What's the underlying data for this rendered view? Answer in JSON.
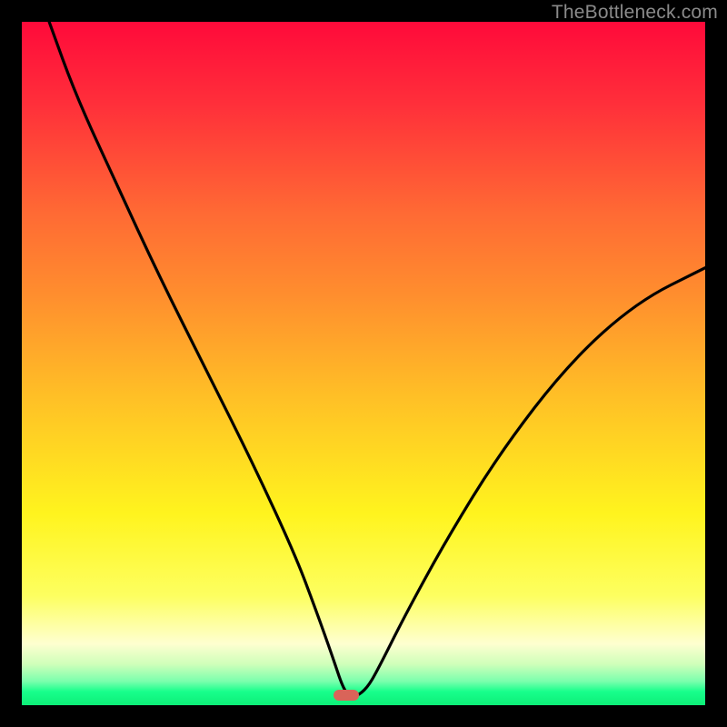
{
  "watermark": "TheBottleneck.com",
  "marker": {
    "x_pct": 47.5,
    "y_pct": 98.6
  },
  "chart_data": {
    "type": "line",
    "title": "",
    "xlabel": "",
    "ylabel": "",
    "xlim": [
      0,
      100
    ],
    "ylim": [
      0,
      100
    ],
    "grid": false,
    "legend": false,
    "x": [
      4,
      8,
      14,
      20,
      27,
      34,
      40,
      43,
      45.5,
      47,
      48,
      49,
      50.5,
      52,
      56,
      62,
      70,
      80,
      90,
      100
    ],
    "values": [
      100,
      89,
      76,
      63,
      49,
      35,
      22,
      14,
      7,
      2.5,
      1.3,
      1.3,
      2.5,
      5,
      13,
      24,
      37,
      50,
      59,
      64
    ],
    "notes": "Values are distance from bottom (0 = bottom/green, 100 = top/red)."
  }
}
